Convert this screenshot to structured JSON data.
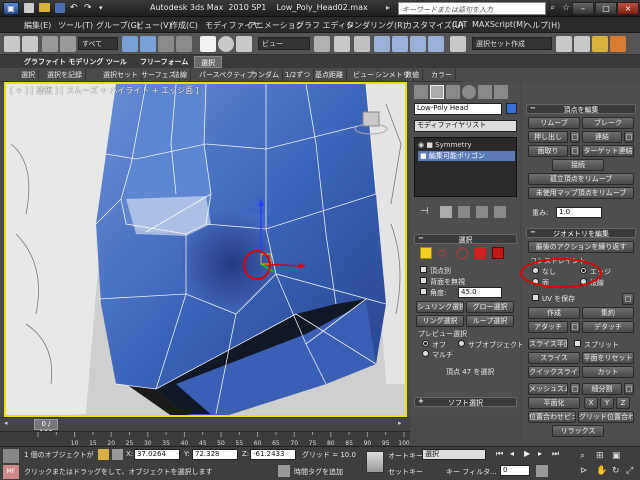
{
  "titlebar": {
    "app": "Autodesk 3ds Max  2010 SP1",
    "file": "Low_Poly_Head02.max",
    "search_placeholder": "キーワードまたは語句を入力"
  },
  "menu": [
    "編集(E)",
    "ツール(T)",
    "グループ(G)",
    "ビュー(V)",
    "作成(C)",
    "モディファイヤ",
    "アニメーション",
    "グラフ エディタ",
    "レンダリング(R)",
    "カスタマイズ(U)",
    "CAT",
    "MAXScript(M)",
    "ヘルプ(H)"
  ],
  "toolbar": {
    "filter": "すべて",
    "view": "ビュー",
    "selection_set": "選択セット作成"
  },
  "ribbon": {
    "title": "グラファイト モデリング ツール",
    "tabs": [
      "フリーフォーム",
      "選択"
    ],
    "active_tab": "選択",
    "buttons": [
      "選択",
      "選択を記録",
      "選択セット",
      "サーフェス",
      "法線",
      "パースペクティブ",
      "ランダム",
      "1/2ずつ",
      "基点距離",
      "ビュー",
      "シンメトリ",
      "数値",
      "カラー"
    ]
  },
  "viewport": {
    "label": "[ + ]  [ 透視 ]  [ スムーズ + ハイライト + エッジ面 ]"
  },
  "command_panel": {
    "object_name": "Low-Poly Head",
    "modifier_list": "モディファイヤリスト",
    "stack": [
      "Symmetry",
      "編集可能ポリゴン"
    ],
    "selection_rollout": {
      "title": "選択",
      "by_vertex": "頂点別",
      "ignore_backfacing": "背面を無視",
      "by_angle": "角度:",
      "angle_value": "45.0",
      "shrink": "シュリンク選択",
      "grow": "グロー選択",
      "ring": "リング選択",
      "loop": "ループ選択",
      "preview_title": "プレビュー選択",
      "preview_off": "オフ",
      "preview_subobj": "サブオブジェクト",
      "preview_multi": "マルチ",
      "status": "頂点 47 を選択"
    },
    "soft_selection": "ソフト選択"
  },
  "right_panel": {
    "edit_vertices": {
      "title": "頂点を編集",
      "remove": "リムーブ",
      "break": "ブレーク",
      "extrude": "押し出し",
      "weld": "連結",
      "chamfer": "面取り",
      "target_weld": "ターゲット連結",
      "connect": "接続",
      "remove_isolated": "孤立頂点をリムーブ",
      "remove_unused_map": "未使用マップ頂点をリムーブ",
      "weight_label": "重み:",
      "weight_value": "1.0"
    },
    "edit_geometry": {
      "title": "ジオメトリを編集",
      "repeat_last": "最後のアクションを繰り返す",
      "constraints": "コンストレイント",
      "none": "なし",
      "edge": "エッジ",
      "face": "面",
      "normal": "法線",
      "preserve_uv": "UV を保存",
      "create": "作成",
      "collapse": "集約",
      "attach": "アタッチ",
      "detach": "デタッチ",
      "slice_plane": "スライス平面",
      "split": "スプリット",
      "slice": "スライス",
      "reset_plane": "平面をリセット",
      "quickslice": "クイックスライス",
      "cut": "カット",
      "meshsmooth": "メッシュスムーズ",
      "tessellate": "細分割",
      "make_planar": "平面化",
      "x": "X",
      "y": "Y",
      "z": "Z",
      "view_align": "位置合わせビュー",
      "grid_align": "グリッド位置合わせ",
      "relax": "リラックス"
    }
  },
  "timeline": {
    "frame": "0 / 100",
    "ticks": [
      "0",
      "10",
      "15",
      "20",
      "25",
      "30",
      "35",
      "40",
      "45",
      "50",
      "55",
      "60",
      "65",
      "70",
      "75",
      "80",
      "85",
      "90",
      "95",
      "100"
    ]
  },
  "status": {
    "selection": "1 個のオブジェクトが",
    "prompt": "クリックまたはドラッグをして、オブジェクトを選択します",
    "x_label": "X:",
    "x_value": "37.0264",
    "y_label": "Y:",
    "y_value": "72.328",
    "z_label": "Z:",
    "z_value": "-61.2433",
    "grid": "グリッド = 10.0",
    "add_time_tag": "時間タグを追加",
    "autokey": "オートキー",
    "setkey": "セットキー",
    "selected": "選択",
    "key_filter": "キー フィルタ...",
    "frame_value": "0"
  }
}
